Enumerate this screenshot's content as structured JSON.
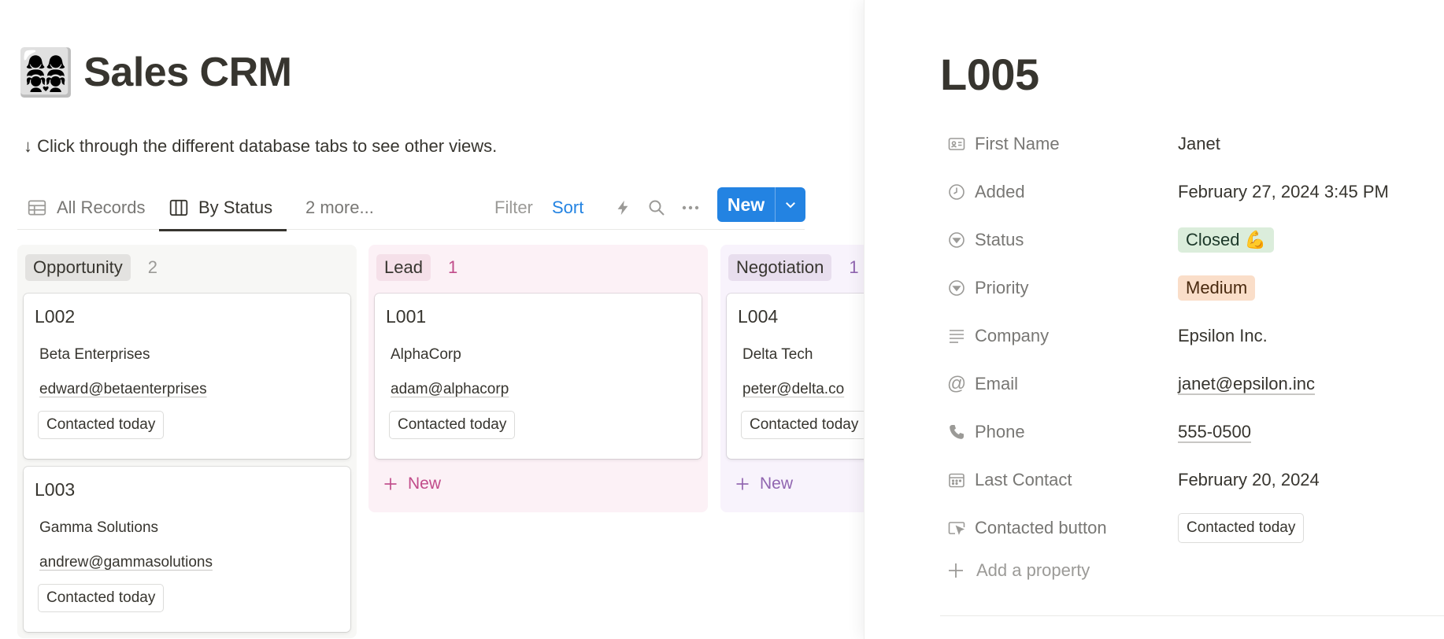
{
  "page": {
    "emoji": "👩‍👩‍👧‍👧",
    "title": "Sales CRM",
    "subtitle": "↓ Click through the different database tabs to see other views."
  },
  "views": {
    "tabs": [
      {
        "label": "All Records",
        "icon": "table-icon",
        "active": false
      },
      {
        "label": "By Status",
        "icon": "board-icon",
        "active": true
      },
      {
        "label": "2 more...",
        "icon": "",
        "active": false
      }
    ],
    "filter_label": "Filter",
    "sort_label": "Sort",
    "new_label": "New",
    "colors": {
      "accent": "#2383e2",
      "muted": "#9b9a97"
    }
  },
  "board": {
    "columns": [
      {
        "label": "Opportunity",
        "count": "2",
        "color": "#e3e2e0",
        "cards": [
          {
            "id": "L002",
            "company": "Beta Enterprises",
            "email": "edward@betaenterprises",
            "button": "Contacted today"
          },
          {
            "id": "L003",
            "company": "Gamma Solutions",
            "email": "andrew@gammasolutions",
            "button": "Contacted today"
          }
        ]
      },
      {
        "label": "Lead",
        "count": "1",
        "color": "#f5e0e9",
        "new_label": "New",
        "cards": [
          {
            "id": "L001",
            "company": "AlphaCorp",
            "email": "adam@alphacorp",
            "button": "Contacted today"
          }
        ]
      },
      {
        "label": "Negotiation",
        "count": "1",
        "color": "#e8deee",
        "new_label": "New",
        "cards": [
          {
            "id": "L004",
            "company": "Delta Tech",
            "email": "peter@delta.co",
            "button": "Contacted today"
          }
        ]
      }
    ]
  },
  "peek": {
    "title": "L005",
    "properties": [
      {
        "name": "First Name",
        "value": "Janet",
        "icon": "contact-card-icon"
      },
      {
        "name": "Added",
        "value": "February 27, 2024 3:45 PM",
        "icon": "clock-icon"
      },
      {
        "name": "Status",
        "value": "Closed 💪",
        "icon": "status-icon",
        "pill_color": "#dbeddb"
      },
      {
        "name": "Priority",
        "value": "Medium",
        "icon": "select-icon",
        "pill_color": "#fadec9"
      },
      {
        "name": "Company",
        "value": "Epsilon Inc.",
        "icon": "text-icon"
      },
      {
        "name": "Email",
        "value": "janet@epsilon.inc",
        "icon": "at-icon"
      },
      {
        "name": "Phone",
        "value": "555-0500",
        "icon": "phone-icon"
      },
      {
        "name": "Last Contact",
        "value": "February 20, 2024",
        "icon": "calendar-icon"
      },
      {
        "name": "Contacted button",
        "value": "Contacted today",
        "icon": "button-cursor-icon"
      }
    ],
    "add_property_label": "Add a property"
  }
}
